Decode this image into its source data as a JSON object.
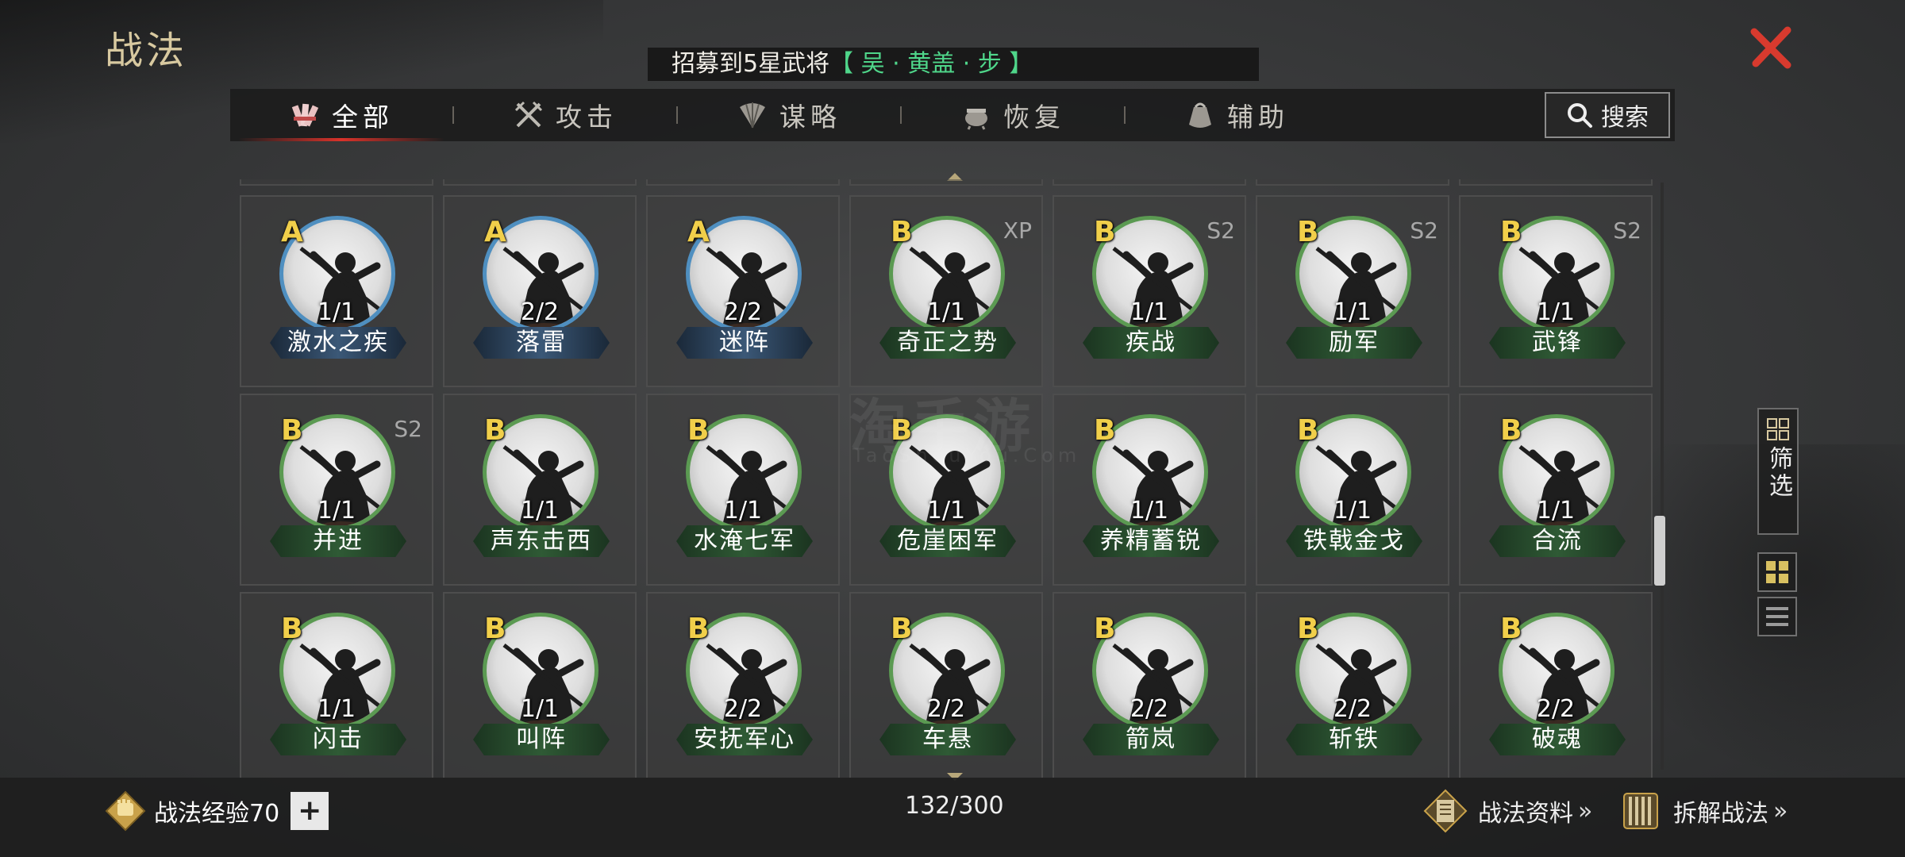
{
  "header": {
    "title": "战法",
    "close_icon": "close-x-icon",
    "accent": "#d83a2e"
  },
  "banner": {
    "prefix": "招募到5星武将",
    "highlight": "【 吴 · 黄盖 · 步 】",
    "highlight_color": "#4fd68a"
  },
  "tabs": [
    {
      "label": "全部",
      "icon": "all-bundle-icon",
      "active": true
    },
    {
      "label": "攻击",
      "icon": "crossed-swords-icon",
      "active": false
    },
    {
      "label": "谋略",
      "icon": "fan-icon",
      "active": false
    },
    {
      "label": "恢复",
      "icon": "cauldron-icon",
      "active": false
    },
    {
      "label": "辅助",
      "icon": "pouch-icon",
      "active": false
    }
  ],
  "search": {
    "label": "搜索"
  },
  "watermark": {
    "text": "淘手游",
    "sub": "TaoShouYou.Com"
  },
  "tactics": [
    {
      "grade": "A",
      "name": "激水之疾",
      "count": "1/1",
      "season": ""
    },
    {
      "grade": "A",
      "name": "落雷",
      "count": "2/2",
      "season": ""
    },
    {
      "grade": "A",
      "name": "迷阵",
      "count": "2/2",
      "season": ""
    },
    {
      "grade": "B",
      "name": "奇正之势",
      "count": "1/1",
      "season": "XP"
    },
    {
      "grade": "B",
      "name": "疾战",
      "count": "1/1",
      "season": "S2"
    },
    {
      "grade": "B",
      "name": "励军",
      "count": "1/1",
      "season": "S2"
    },
    {
      "grade": "B",
      "name": "武锋",
      "count": "1/1",
      "season": "S2"
    },
    {
      "grade": "B",
      "name": "并进",
      "count": "1/1",
      "season": "S2"
    },
    {
      "grade": "B",
      "name": "声东击西",
      "count": "1/1",
      "season": ""
    },
    {
      "grade": "B",
      "name": "水淹七军",
      "count": "1/1",
      "season": ""
    },
    {
      "grade": "B",
      "name": "危崖困军",
      "count": "1/1",
      "season": ""
    },
    {
      "grade": "B",
      "name": "养精蓄锐",
      "count": "1/1",
      "season": ""
    },
    {
      "grade": "B",
      "name": "铁戟金戈",
      "count": "1/1",
      "season": ""
    },
    {
      "grade": "B",
      "name": "合流",
      "count": "1/1",
      "season": ""
    },
    {
      "grade": "B",
      "name": "闪击",
      "count": "1/1",
      "season": ""
    },
    {
      "grade": "B",
      "name": "叫阵",
      "count": "1/1",
      "season": ""
    },
    {
      "grade": "B",
      "name": "安抚军心",
      "count": "2/2",
      "season": ""
    },
    {
      "grade": "B",
      "name": "车悬",
      "count": "2/2",
      "season": ""
    },
    {
      "grade": "B",
      "name": "箭岚",
      "count": "2/2",
      "season": ""
    },
    {
      "grade": "B",
      "name": "斩铁",
      "count": "2/2",
      "season": ""
    },
    {
      "grade": "B",
      "name": "破魂",
      "count": "2/2",
      "season": ""
    }
  ],
  "side": {
    "filter_label": "筛选",
    "filter_icon": "filter-grid-icon",
    "grid_view_icon": "grid-view-icon",
    "list_view_icon": "list-view-icon"
  },
  "footer": {
    "exp_label": "战法经验70",
    "exp_icon": "fist-badge-icon",
    "add_label": "+",
    "capacity": "132/300",
    "info_label": "战法资料",
    "info_icon": "scroll-book-icon",
    "disassemble_label": "拆解战法",
    "disassemble_icon": "bamboo-scroll-icon",
    "chevrons": "»"
  }
}
